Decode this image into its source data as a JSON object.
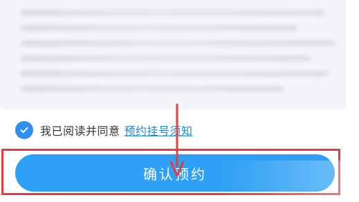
{
  "agreement": {
    "checked": true,
    "text": "我已阅读并同意",
    "link_label": "预约挂号须知"
  },
  "confirm_button": {
    "label": "确认预约"
  },
  "colors": {
    "primary_button": "#2ea0f5",
    "checkbox": "#2f8ff0",
    "link": "#1a86d8",
    "annotation_red": "#e83b3b"
  },
  "icons": {
    "checkbox": "check-icon",
    "annotation": "down-arrow-icon"
  }
}
